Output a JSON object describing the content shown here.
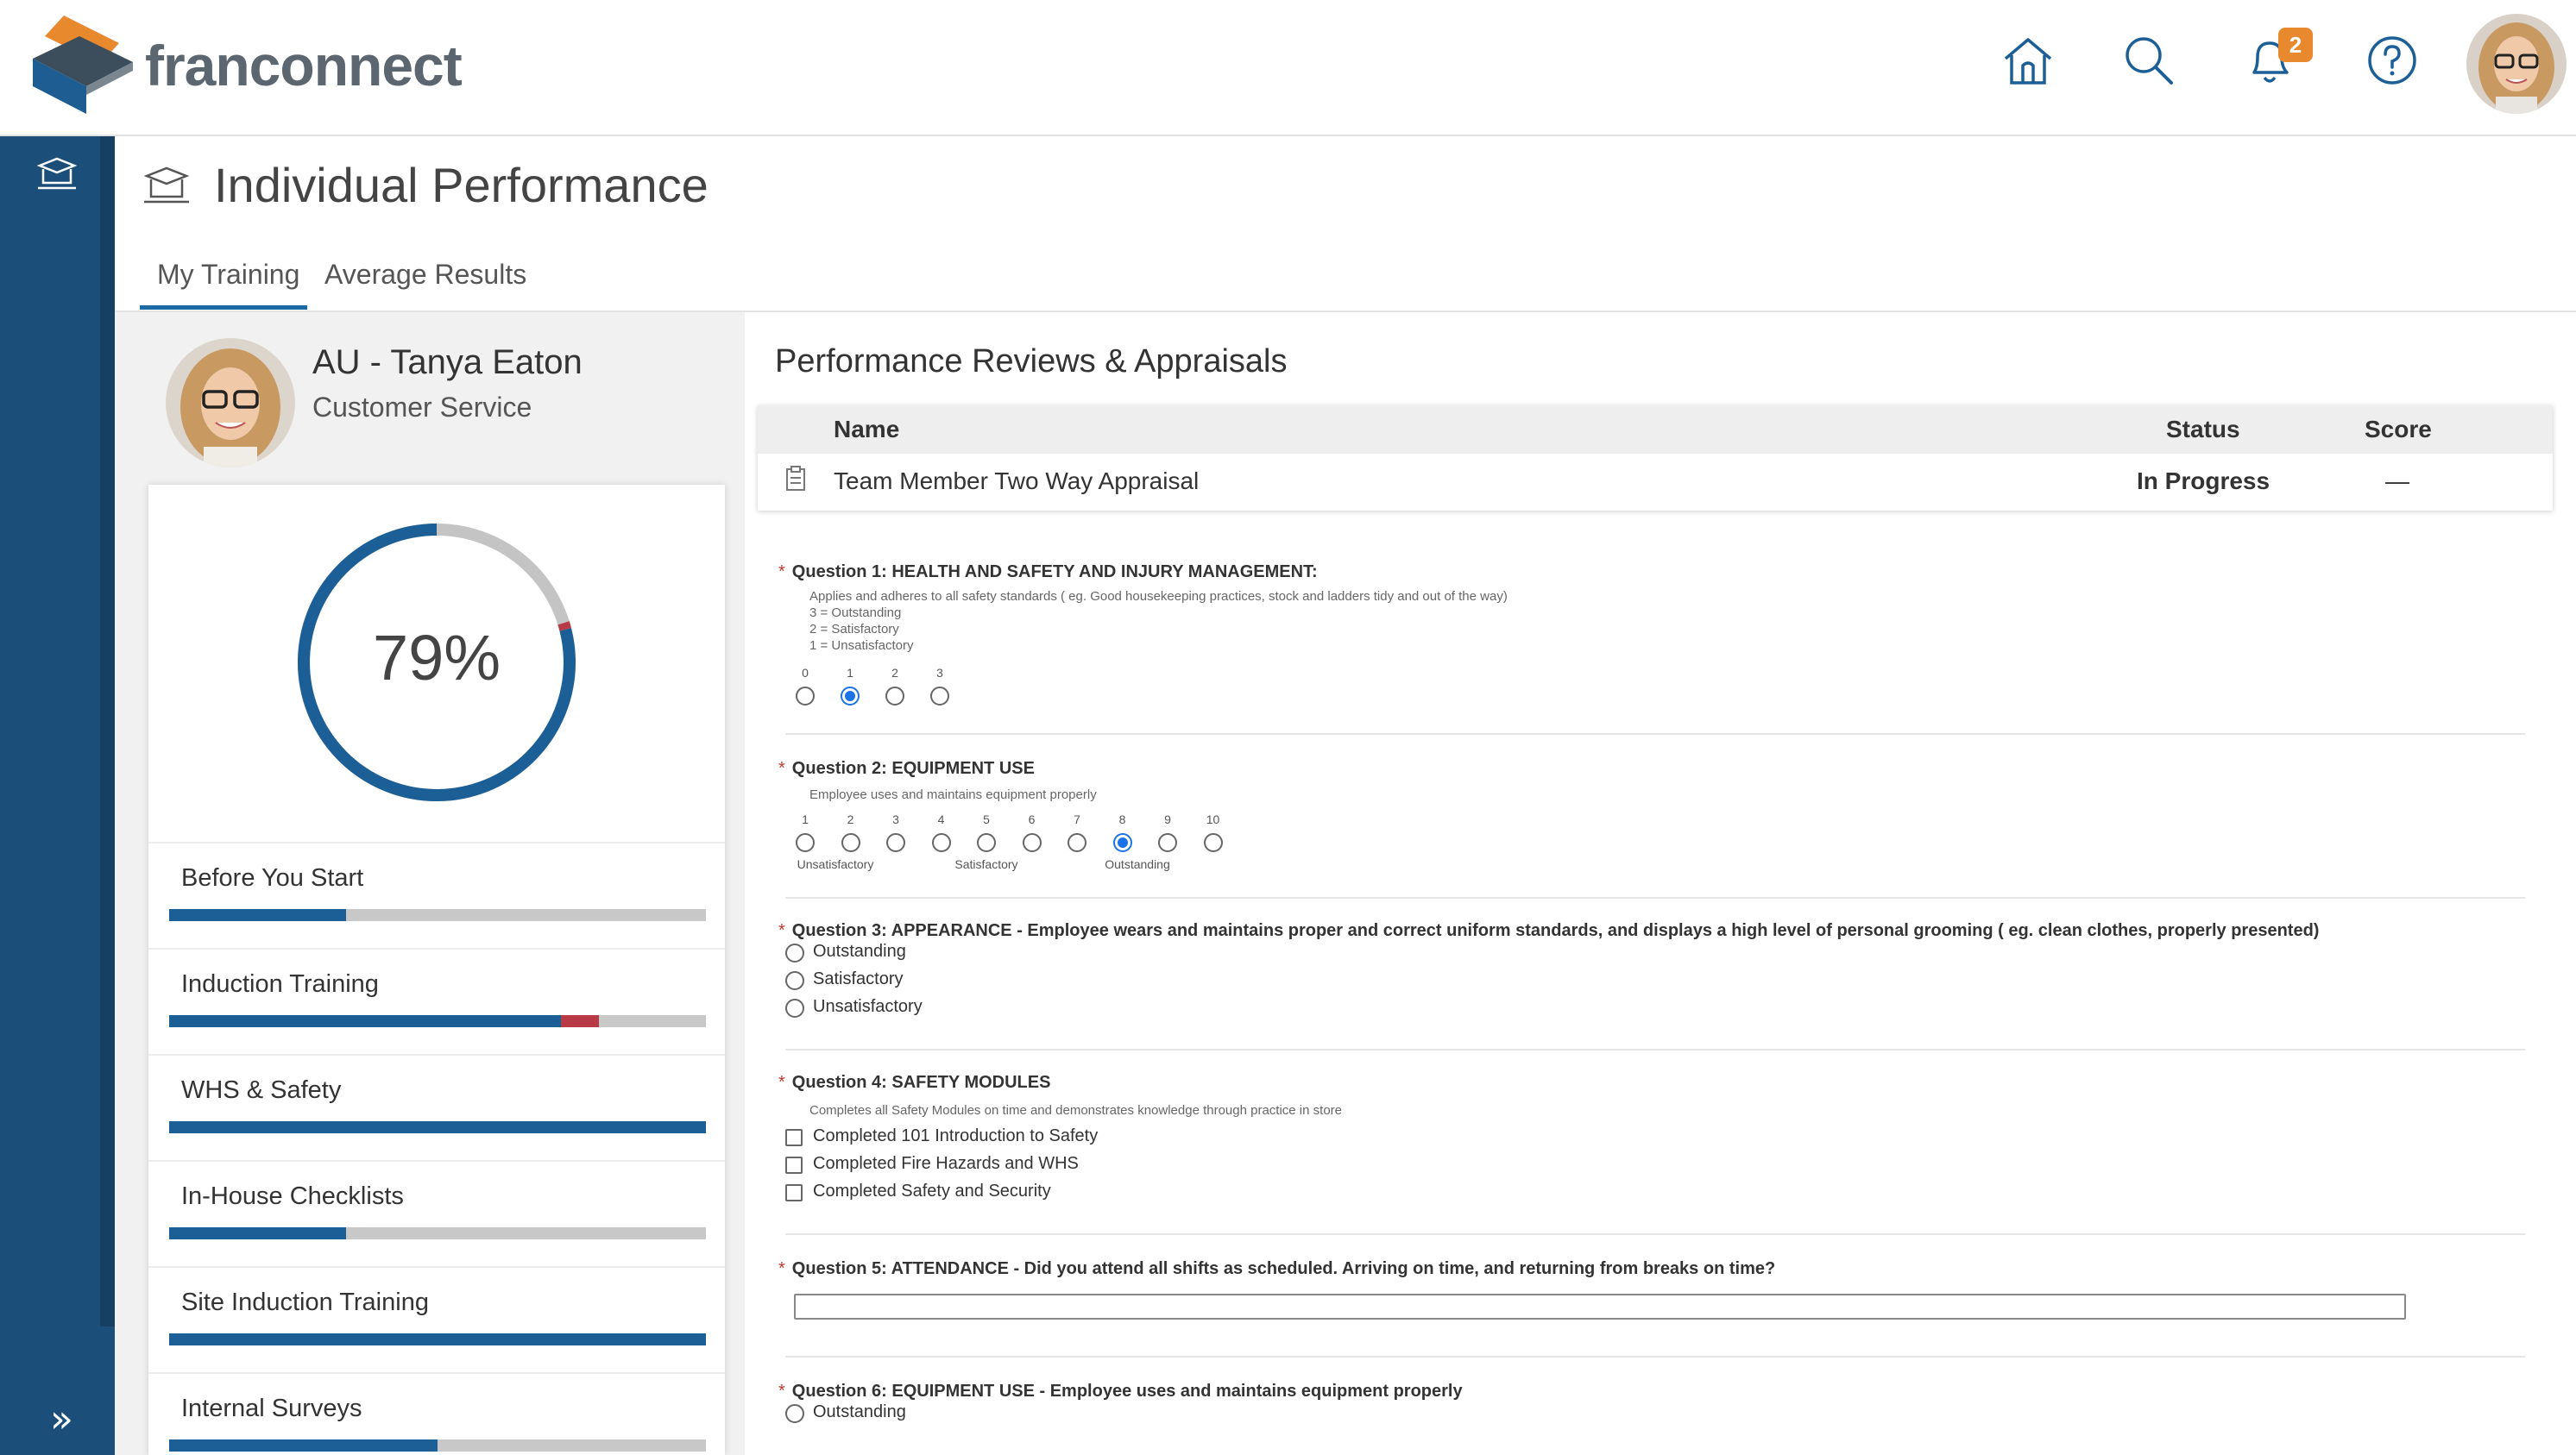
{
  "app": {
    "logo_text": "franconnect",
    "notification_count": "2",
    "colors": {
      "brand_blue": "#1b4f7a",
      "accent_orange": "#e8892e",
      "progress_blue": "#1b5f96",
      "progress_red": "#b83a47"
    }
  },
  "header": {
    "icons": [
      "home-icon",
      "search-icon",
      "bell-icon",
      "help-icon"
    ]
  },
  "page": {
    "title": "Individual Performance",
    "tabs": [
      {
        "label": "My Training",
        "active": true
      },
      {
        "label": "Average Results",
        "active": false
      }
    ]
  },
  "profile": {
    "name": "AU - Tanya Eaton",
    "role": "Customer Service",
    "overall_progress": 0.79,
    "overall_label": "79%"
  },
  "progress_items": [
    {
      "label": "Before You Start",
      "complete": 0.33,
      "overdue": 0
    },
    {
      "label": "Induction Training",
      "complete": 0.73,
      "overdue": 0.07
    },
    {
      "label": "WHS & Safety",
      "complete": 1.0,
      "overdue": 0
    },
    {
      "label": "In-House Checklists",
      "complete": 0.33,
      "overdue": 0
    },
    {
      "label": "Site Induction Training",
      "complete": 1.0,
      "overdue": 0
    },
    {
      "label": "Internal Surveys",
      "complete": 0.5,
      "overdue": 0
    }
  ],
  "reviews": {
    "section_title": "Performance Reviews & Appraisals",
    "columns": {
      "name": "Name",
      "status": "Status",
      "score": "Score"
    },
    "rows": [
      {
        "name": "Team Member Two Way Appraisal",
        "status": "In Progress",
        "score": "—"
      }
    ]
  },
  "form": {
    "q1": {
      "title": "Question 1: HEALTH AND SAFETY AND INJURY MANAGEMENT:",
      "description": "Applies and adheres to all safety standards ( eg. Good housekeeping practices, stock and ladders tidy and out of the way)\n3 = Outstanding\n2 = Satisfactory\n1 = Unsatisfactory",
      "scale": [
        "0",
        "1",
        "2",
        "3"
      ],
      "selected": "1"
    },
    "q2": {
      "title": "Question 2: EQUIPMENT USE",
      "description": "Employee uses and maintains equipment properly",
      "scale": [
        "1",
        "2",
        "3",
        "4",
        "5",
        "6",
        "7",
        "8",
        "9",
        "10"
      ],
      "selected": "8",
      "captions": [
        "Unsatisfactory",
        "Satisfactory",
        "Outstanding"
      ]
    },
    "q3": {
      "title": "Question 3: APPEARANCE - Employee wears and maintains proper and correct uniform standards, and displays a high level of personal grooming ( eg. clean clothes, properly presented)",
      "options": [
        "Outstanding",
        "Satisfactory",
        "Unsatisfactory"
      ]
    },
    "q4": {
      "title": "Question 4: SAFETY MODULES",
      "description": "Completes all Safety Modules on time and demonstrates knowledge through practice in store",
      "options": [
        "Completed 101 Introduction to Safety",
        "Completed Fire Hazards and WHS",
        "Completed Safety and Security"
      ]
    },
    "q5": {
      "title": "Question 5: ATTENDANCE - Did you attend all shifts as scheduled. Arriving on time, and returning from breaks on time?",
      "value": ""
    },
    "q6": {
      "title": "Question 6: EQUIPMENT USE - Employee uses and maintains equipment properly",
      "options": [
        "Outstanding"
      ]
    }
  }
}
